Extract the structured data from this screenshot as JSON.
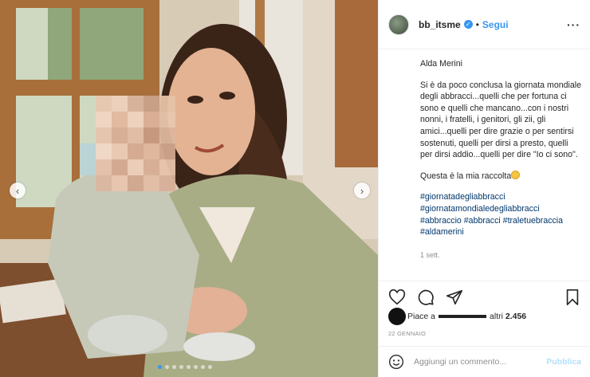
{
  "post": {
    "username": "bb_itsme",
    "separator": "•",
    "follow_label": "Segui",
    "more_icon": "more-horizontal-icon",
    "verified_icon": "verified-badge-icon"
  },
  "caption": {
    "author_line": "Alda Merini",
    "body": "Si è da poco conclusa la giornata mondiale degli abbracci...quelli che per fortuna ci sono e quelli che mancano...con i nostri nonni, i fratelli, i genitori, gli zii, gli amici...quelli per dire grazie o per sentirsi sostenuti, quelli per dirsi a presto, quelli per dirsi addio...quelli per dire \"Io ci sono\".",
    "collection_line": "Questa è la mia raccolta",
    "hashtags": [
      "#giornatadegliabbracci",
      "#giornatamondialedegliabbracci",
      "#abbraccio",
      "#abbracci",
      "#traletuebraccia",
      "#aldamerini"
    ],
    "time_ago": "1 sett."
  },
  "actions": {
    "like_icon": "heart-icon",
    "comment_icon": "comment-icon",
    "share_icon": "share-icon",
    "save_icon": "bookmark-icon"
  },
  "likes": {
    "prefix": "Piace a",
    "suffix": "altri",
    "count": "2.456"
  },
  "date": "22 GENNAIO",
  "comment": {
    "placeholder": "Aggiungi un commento...",
    "publish_label": "Pubblica",
    "emoji_icon": "smiley-icon"
  },
  "carousel": {
    "prev_icon": "chevron-left-icon",
    "next_icon": "chevron-right-icon",
    "slides": 8,
    "active_slide": 1
  },
  "colors": {
    "link_blue": "#3897f0",
    "hashtag": "#00376b",
    "muted": "#8e8e8e",
    "publish_disabled": "#b2dffc"
  }
}
